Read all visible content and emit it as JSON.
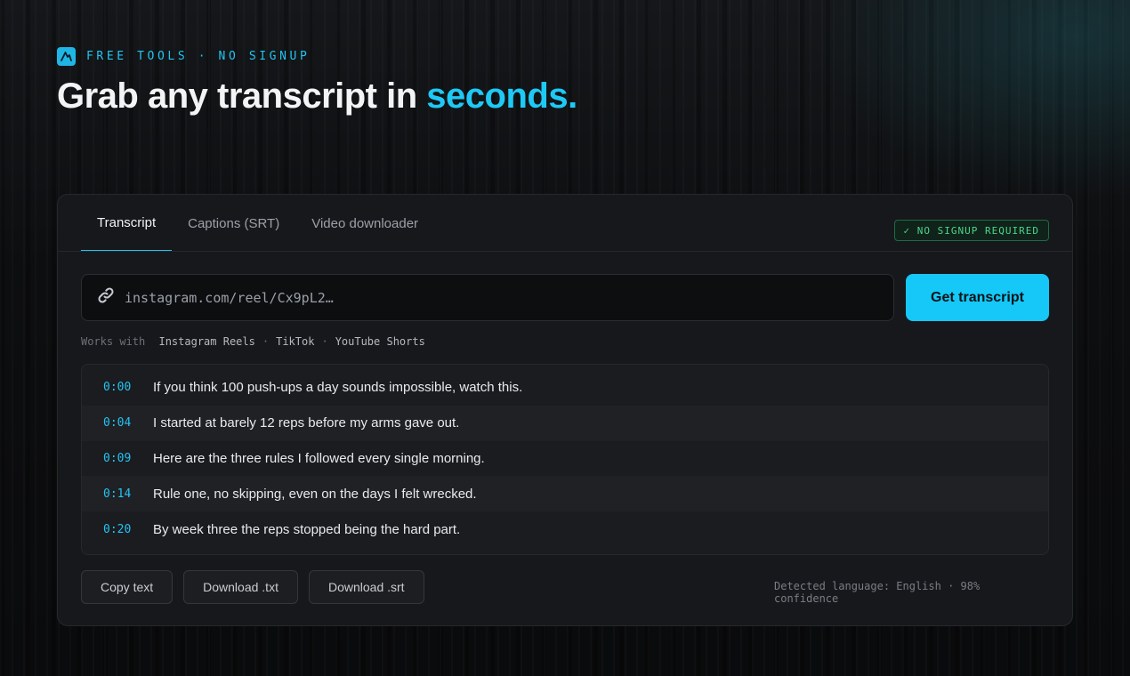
{
  "header": {
    "eyebrow": "FREE TOOLS · NO SIGNUP",
    "title_main": "Grab any transcript in ",
    "title_accent": "seconds."
  },
  "tabs": [
    {
      "label": "Transcript",
      "active": true
    },
    {
      "label": "Captions (SRT)",
      "active": false
    },
    {
      "label": "Video downloader",
      "active": false
    }
  ],
  "badge": "✓ NO SIGNUP REQUIRED",
  "search": {
    "value": "",
    "placeholder": "instagram.com/reel/Cx9pL2…",
    "button_label": "Get transcript"
  },
  "works_with": {
    "label": "Works with",
    "platforms": [
      "Instagram Reels",
      "TikTok",
      "YouTube Shorts"
    ],
    "separator": "·"
  },
  "transcript": [
    {
      "time": "0:00",
      "text": "If you think 100 push-ups a day sounds impossible, watch this."
    },
    {
      "time": "0:04",
      "text": "I started at barely 12 reps before my arms gave out."
    },
    {
      "time": "0:09",
      "text": "Here are the three rules I followed every single morning."
    },
    {
      "time": "0:14",
      "text": "Rule one, no skipping, even on the days I felt wrecked."
    },
    {
      "time": "0:20",
      "text": "By week three the reps stopped being the hard part."
    }
  ],
  "actions": {
    "copy": "Copy text",
    "download_txt": "Download .txt",
    "download_srt": "Download .srt"
  },
  "detected": "Detected language: English · 98% confidence",
  "colors": {
    "accent": "#1ec9f5",
    "badge_green": "#4cd58a",
    "background": "#0b0c0e",
    "card": "#17181b"
  },
  "icons": {
    "logo": "logo-icon",
    "link": "link-icon"
  }
}
